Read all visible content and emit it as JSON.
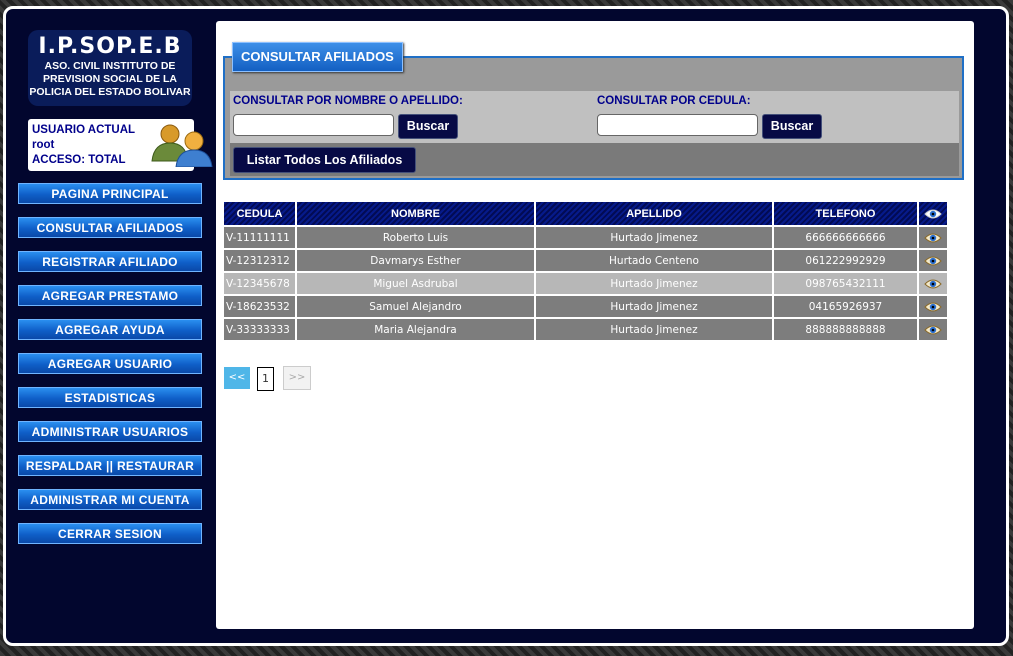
{
  "logo": {
    "title": "I.P.SOP.E.B",
    "line1": "ASO. CIVIL INSTITUTO DE",
    "line2": "PREVISION SOCIAL DE LA",
    "line3": "POLICIA DEL ESTADO BOLIVAR"
  },
  "user": {
    "label": "USUARIO ACTUAL",
    "name": "root",
    "access": "ACCESO: TOTAL",
    "icon": "users-icon"
  },
  "menu": [
    {
      "label": "PAGINA PRINCIPAL"
    },
    {
      "label": "CONSULTAR AFILIADOS"
    },
    {
      "label": "REGISTRAR AFILIADO"
    },
    {
      "label": "AGREGAR PRESTAMO"
    },
    {
      "label": "AGREGAR AYUDA"
    },
    {
      "label": "AGREGAR USUARIO"
    },
    {
      "label": "ESTADISTICAS"
    },
    {
      "label": "ADMINISTRAR USUARIOS"
    },
    {
      "label": "RESPALDAR || RESTAURAR"
    },
    {
      "label": "ADMINISTRAR MI CUENTA"
    },
    {
      "label": "CERRAR SESION"
    }
  ],
  "search": {
    "panel_title": "CONSULTAR AFILIADOS",
    "by_name_label": "CONSULTAR POR NOMBRE O APELLIDO:",
    "by_name_value": "",
    "by_id_label": "CONSULTAR POR CEDULA:",
    "by_id_value": "",
    "search_button": "Buscar",
    "list_all_button": "Listar Todos Los Afiliados"
  },
  "table": {
    "headers": [
      "CEDULA",
      "NOMBRE",
      "APELLIDO",
      "TELEFONO"
    ],
    "view_icon": "eye-icon",
    "rows": [
      {
        "cedula": "V-11111111",
        "nombre": "Roberto Luis",
        "apellido": "Hurtado Jimenez",
        "telefono": "666666666666"
      },
      {
        "cedula": "V-12312312",
        "nombre": "Davmarys Esther",
        "apellido": "Hurtado Centeno",
        "telefono": "061222992929"
      },
      {
        "cedula": "V-12345678",
        "nombre": "Miguel Asdrubal",
        "apellido": "Hurtado Jimenez",
        "telefono": "098765432111"
      },
      {
        "cedula": "V-18623532",
        "nombre": "Samuel Alejandro",
        "apellido": "Hurtado Jimenez",
        "telefono": "04165926937"
      },
      {
        "cedula": "V-33333333",
        "nombre": "Maria Alejandra",
        "apellido": "Hurtado Jimenez",
        "telefono": "888888888888"
      }
    ]
  },
  "pager": {
    "prev": "<<",
    "page": "1",
    "next": ">>"
  }
}
